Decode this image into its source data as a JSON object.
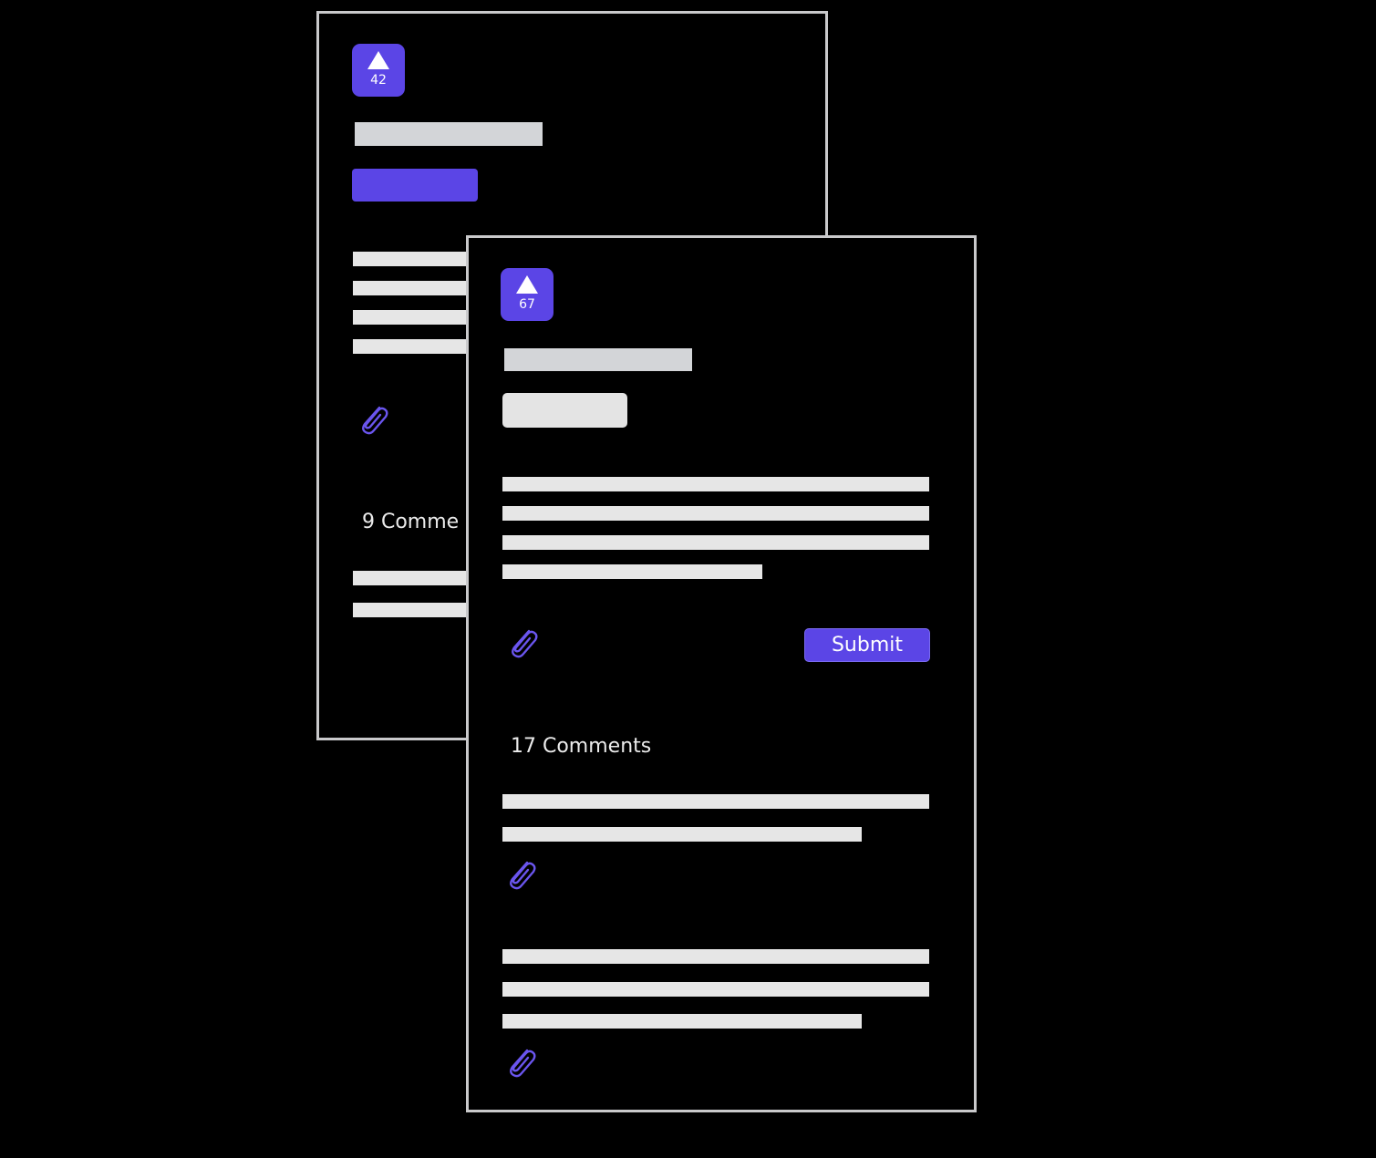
{
  "colors": {
    "accent": "#5b45e6",
    "card_border": "#c9c9cb",
    "placeholder": "#e6e6e6",
    "background": "#000000"
  },
  "back_card": {
    "upvote_count": "42",
    "comments_label": "9 Comme",
    "icons": [
      "upvote-arrow-icon",
      "paperclip-icon"
    ]
  },
  "front_card": {
    "upvote_count": "67",
    "submit_label": "Submit",
    "comments_label": "17 Comments",
    "icons": [
      "upvote-arrow-icon",
      "paperclip-icon"
    ]
  }
}
